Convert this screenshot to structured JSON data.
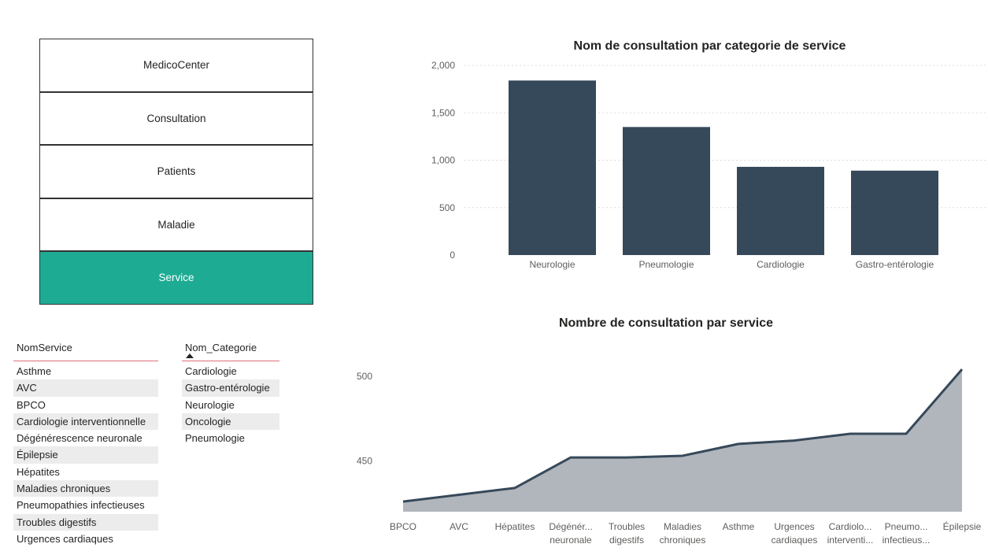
{
  "nav": {
    "items": [
      {
        "label": "MedicoCenter",
        "active": false
      },
      {
        "label": "Consultation",
        "active": false
      },
      {
        "label": "Patients",
        "active": false
      },
      {
        "label": "Maladie",
        "active": false
      },
      {
        "label": "Service",
        "active": true
      }
    ],
    "active_color": "#1eab94"
  },
  "slicer_service": {
    "header": "NomService",
    "items": [
      "Asthme",
      "AVC",
      "BPCO",
      "Cardiologie interventionnelle",
      "Dégénérescence neuronale",
      "Épilepsie",
      "Hépatites",
      "Maladies chroniques",
      "Pneumopathies infectieuses",
      "Troubles digestifs",
      "Urgences cardiaques"
    ]
  },
  "slicer_categorie": {
    "header": "Nom_Categorie",
    "items": [
      "Cardiologie",
      "Gastro-entérologie",
      "Neurologie",
      "Oncologie",
      "Pneumologie"
    ]
  },
  "chart_data": [
    {
      "type": "bar",
      "title": "Nom de consultation par categorie de service",
      "categories": [
        "Neurologie",
        "Pneumologie",
        "Cardiologie",
        "Gastro-entérologie"
      ],
      "values": [
        1840,
        1350,
        930,
        890
      ],
      "ylim": [
        0,
        2000
      ],
      "yticks": [
        0,
        500,
        1000,
        1500,
        2000
      ],
      "ytick_labels": [
        "0",
        "500",
        "1,000",
        "1,500",
        "2,000"
      ],
      "grid": true,
      "color": "#36495a"
    },
    {
      "type": "area",
      "title": "Nombre de consultation par service",
      "categories": [
        [
          "BPCO"
        ],
        [
          "AVC"
        ],
        [
          "Hépatites"
        ],
        [
          "Dégénér...",
          "neuronale"
        ],
        [
          "Troubles",
          "digestifs"
        ],
        [
          "Maladies",
          "chroniques"
        ],
        [
          "Asthme"
        ],
        [
          "Urgences",
          "cardiaques"
        ],
        [
          "Cardiolo...",
          "interventi..."
        ],
        [
          "Pneumo...",
          "infectieus..."
        ],
        [
          "Épilepsie"
        ]
      ],
      "values": [
        426,
        430,
        434,
        452,
        452,
        453,
        460,
        462,
        466,
        466,
        504
      ],
      "ylim": [
        420,
        505
      ],
      "yticks": [
        450,
        500
      ],
      "ytick_labels": [
        "450",
        "500"
      ],
      "grid": false,
      "line_color": "#36495a",
      "fill_color": "#b1b6bc"
    }
  ]
}
